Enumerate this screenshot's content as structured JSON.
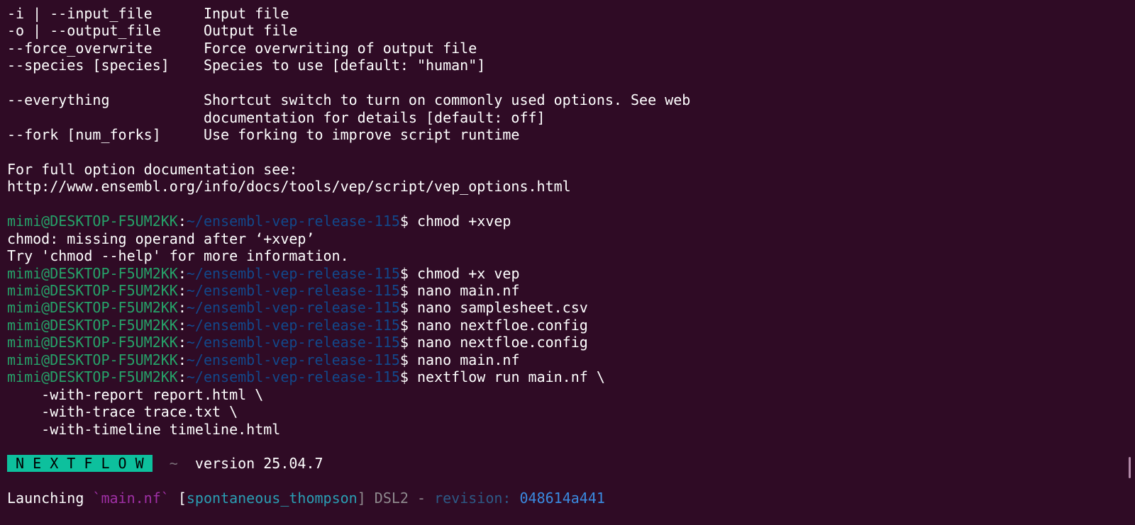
{
  "colors": {
    "background": "#2f0b25",
    "user": "#26a269",
    "path": "#12488b",
    "badge": "#0dc09d"
  },
  "lines": [
    [
      {
        "t": "-i | --input_file      Input file"
      }
    ],
    [
      {
        "t": "-o | --output_file     Output file"
      }
    ],
    [
      {
        "t": "--force_overwrite      Force overwriting of output file"
      }
    ],
    [
      {
        "t": "--species [species]    Species to use [default: \"human\"]"
      }
    ],
    [],
    [
      {
        "t": "--everything           Shortcut switch to turn on commonly used options. See web"
      }
    ],
    [
      {
        "t": "                       documentation for details [default: off]"
      }
    ],
    [
      {
        "t": "--fork [num_forks]     Use forking to improve script runtime"
      }
    ],
    [],
    [
      {
        "t": "For full option documentation see:"
      }
    ],
    [
      {
        "t": "http://www.ensembl.org/info/docs/tools/vep/script/vep_options.html"
      }
    ],
    [],
    [
      {
        "t": "mimi@DESKTOP-F5UM2KK",
        "c": "user"
      },
      {
        "t": ":"
      },
      {
        "t": "~/ensembl-vep-release-115",
        "c": "path"
      },
      {
        "t": "$ chmod +xvep"
      }
    ],
    [
      {
        "t": "chmod: missing operand after ‘+xvep’"
      }
    ],
    [
      {
        "t": "Try 'chmod --help' for more information."
      }
    ],
    [
      {
        "t": "mimi@DESKTOP-F5UM2KK",
        "c": "user"
      },
      {
        "t": ":"
      },
      {
        "t": "~/ensembl-vep-release-115",
        "c": "path"
      },
      {
        "t": "$ chmod +x vep"
      }
    ],
    [
      {
        "t": "mimi@DESKTOP-F5UM2KK",
        "c": "user"
      },
      {
        "t": ":"
      },
      {
        "t": "~/ensembl-vep-release-115",
        "c": "path"
      },
      {
        "t": "$ nano main.nf"
      }
    ],
    [
      {
        "t": "mimi@DESKTOP-F5UM2KK",
        "c": "user"
      },
      {
        "t": ":"
      },
      {
        "t": "~/ensembl-vep-release-115",
        "c": "path"
      },
      {
        "t": "$ nano samplesheet.csv"
      }
    ],
    [
      {
        "t": "mimi@DESKTOP-F5UM2KK",
        "c": "user"
      },
      {
        "t": ":"
      },
      {
        "t": "~/ensembl-vep-release-115",
        "c": "path"
      },
      {
        "t": "$ nano nextfloe.config"
      }
    ],
    [
      {
        "t": "mimi@DESKTOP-F5UM2KK",
        "c": "user"
      },
      {
        "t": ":"
      },
      {
        "t": "~/ensembl-vep-release-115",
        "c": "path"
      },
      {
        "t": "$ nano nextfloe.config"
      }
    ],
    [
      {
        "t": "mimi@DESKTOP-F5UM2KK",
        "c": "user"
      },
      {
        "t": ":"
      },
      {
        "t": "~/ensembl-vep-release-115",
        "c": "path"
      },
      {
        "t": "$ nano main.nf"
      }
    ],
    [
      {
        "t": "mimi@DESKTOP-F5UM2KK",
        "c": "user"
      },
      {
        "t": ":"
      },
      {
        "t": "~/ensembl-vep-release-115",
        "c": "path"
      },
      {
        "t": "$ nextflow run main.nf \\"
      }
    ],
    [
      {
        "t": "    -with-report report.html \\"
      }
    ],
    [
      {
        "t": "    -with-trace trace.txt \\"
      }
    ],
    [
      {
        "t": "    -with-timeline timeline.html"
      }
    ],
    [],
    [
      {
        "t": " N E X T F L O W ",
        "c": "badge"
      },
      {
        "t": "  ~  ",
        "c": "dim"
      },
      {
        "t": "version 25.04.7"
      }
    ],
    [],
    [
      {
        "t": "Launching "
      },
      {
        "t": "`main.nf`",
        "c": "mag"
      },
      {
        "t": " ["
      },
      {
        "t": "spontaneous_thompson",
        "c": "cyan"
      },
      {
        "t": "] DSL2 - ",
        "c": "grey"
      },
      {
        "t": "revision: ",
        "c": "darkblue"
      },
      {
        "t": "048614a441",
        "c": "blue"
      }
    ]
  ]
}
